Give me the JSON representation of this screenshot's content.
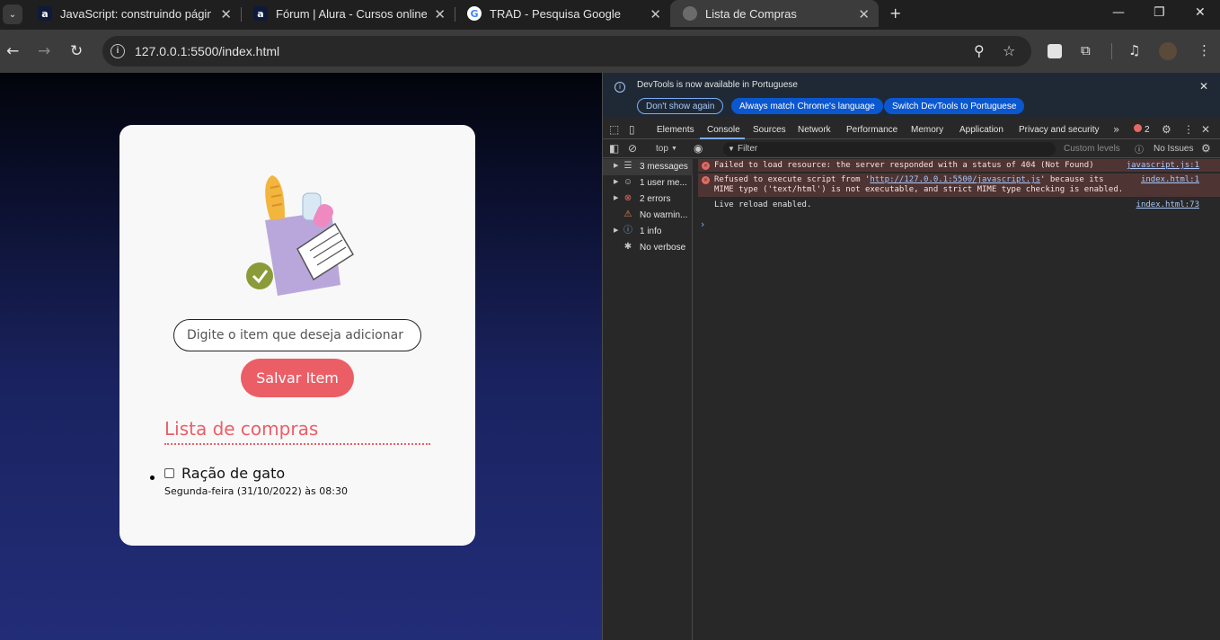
{
  "browser": {
    "tabs": [
      {
        "title": "JavaScript: construindo páginas",
        "favicon": "a",
        "active": false
      },
      {
        "title": "Fórum | Alura - Cursos online de",
        "favicon": "a",
        "active": false
      },
      {
        "title": "TRAD - Pesquisa Google",
        "favicon": "G",
        "active": false
      },
      {
        "title": "Lista de Compras",
        "favicon": "globe",
        "active": true
      }
    ],
    "new_tab": "+",
    "url": "127.0.0.1:5500/index.html"
  },
  "app": {
    "input_placeholder": "Digite o item que deseja adicionar",
    "save_button": "Salvar Item",
    "list_title": "Lista de compras",
    "items": [
      {
        "name": "Ração de gato",
        "date": "Segunda-feira (31/10/2022) às 08:30",
        "checked": false
      }
    ],
    "accent_color": "#ec5e66"
  },
  "devtools": {
    "notice": {
      "message": "DevTools is now available in Portuguese",
      "buttons": [
        "Don't show again",
        "Always match Chrome's language",
        "Switch DevTools to Portuguese"
      ]
    },
    "tabs": [
      "Elements",
      "Console",
      "Sources",
      "Network",
      "Performance",
      "Memory",
      "Application",
      "Privacy and security"
    ],
    "active_tab": "Console",
    "error_count": "2",
    "console_bar": {
      "context": "top",
      "filter_placeholder": "Filter",
      "levels": "Custom levels",
      "issues": "No Issues"
    },
    "sidebar": [
      {
        "label": "3 messages",
        "icon": "list-icon"
      },
      {
        "label": "1 user me...",
        "icon": "user-icon"
      },
      {
        "label": "2 errors",
        "icon": "error-icon"
      },
      {
        "label": "No warnin...",
        "icon": "warning-icon"
      },
      {
        "label": "1 info",
        "icon": "info-icon"
      },
      {
        "label": "No verbose",
        "icon": "bug-icon"
      }
    ],
    "logs": [
      {
        "type": "error",
        "text": "Failed to load resource: the server responded with a status of 404 (Not Found)",
        "source": "javascript.js:1"
      },
      {
        "type": "error",
        "text_before": "Refused to execute script from '",
        "link": "http://127.0.0.1:5500/javascript.js",
        "text_after": "' because its MIME type ('text/html') is not executable, and strict MIME type checking is enabled.",
        "source": "index.html:1"
      },
      {
        "type": "log",
        "text": "Live reload enabled.",
        "source": "index.html:73"
      }
    ]
  }
}
